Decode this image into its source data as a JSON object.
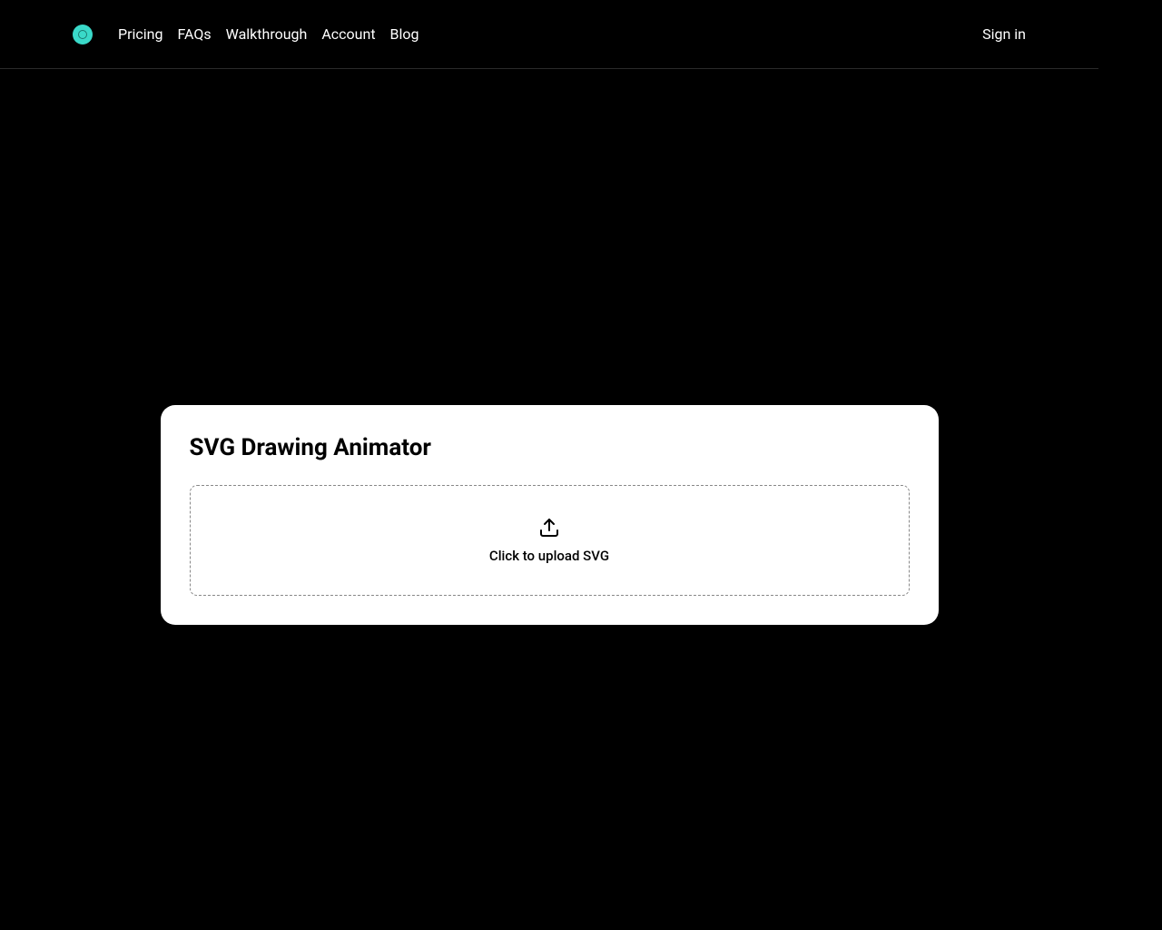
{
  "header": {
    "nav": {
      "items": [
        "Pricing",
        "FAQs",
        "Walkthrough",
        "Account",
        "Blog"
      ]
    },
    "signin": "Sign in"
  },
  "card": {
    "title": "SVG Drawing Animator",
    "upload_text": "Click to upload SVG"
  }
}
